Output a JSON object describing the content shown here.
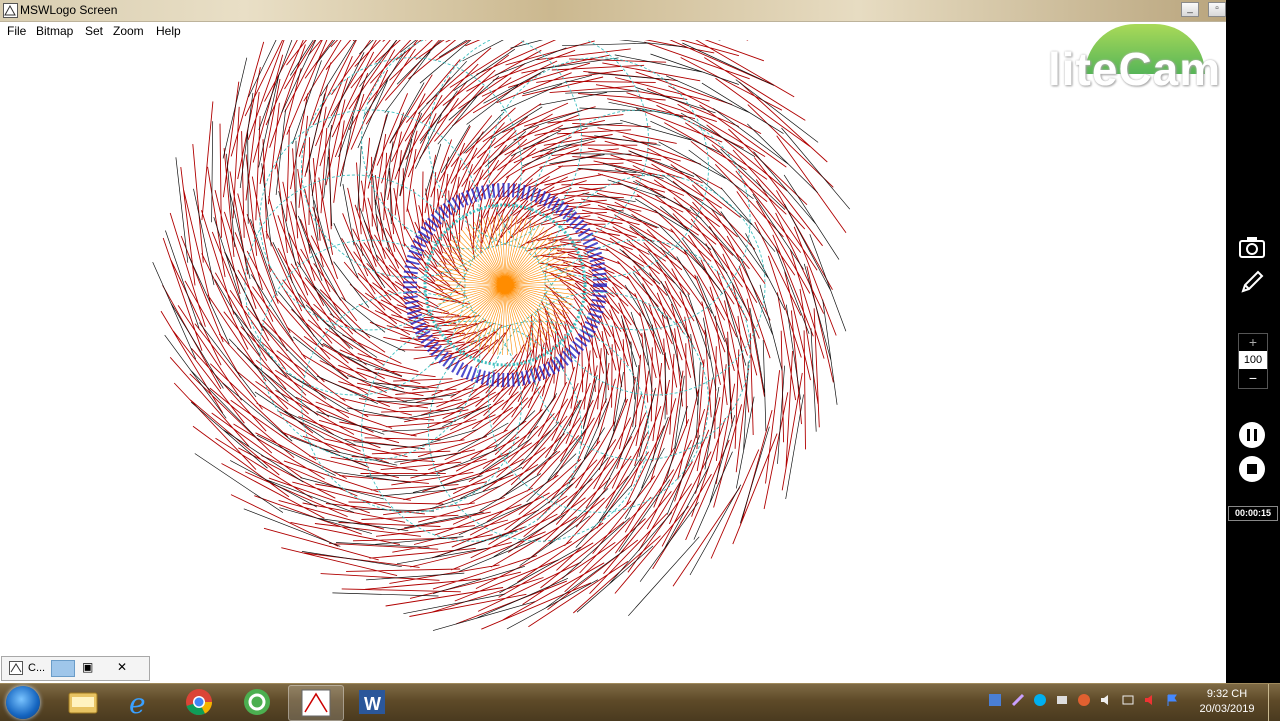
{
  "window": {
    "title": "MSWLogo Screen",
    "menu": [
      "File",
      "Bitmap",
      "Set",
      "Zoom",
      "Help"
    ]
  },
  "watermark": {
    "text": "liteCam"
  },
  "recorder": {
    "zoom_value": "100",
    "zoom_plus": "+",
    "zoom_minus": "−",
    "timer": "00:00:15",
    "icons": [
      "camera-icon",
      "pen-icon",
      "pause-icon",
      "stop-icon"
    ]
  },
  "minimized_window": {
    "label": "C..."
  },
  "taskbar": {
    "apps": [
      "windows-explorer-icon",
      "internet-explorer-icon",
      "chrome-icon",
      "coccoc-icon",
      "mswlogo-icon",
      "word-icon"
    ],
    "clock_time": "9:32 CH",
    "clock_date": "20/03/2019"
  },
  "colors": {
    "drawing_red": "#b00000",
    "drawing_blue": "#2020c0",
    "drawing_cyan": "#40c0c0",
    "drawing_orange": "#ff8c00",
    "recorder_bg": "#000000"
  }
}
